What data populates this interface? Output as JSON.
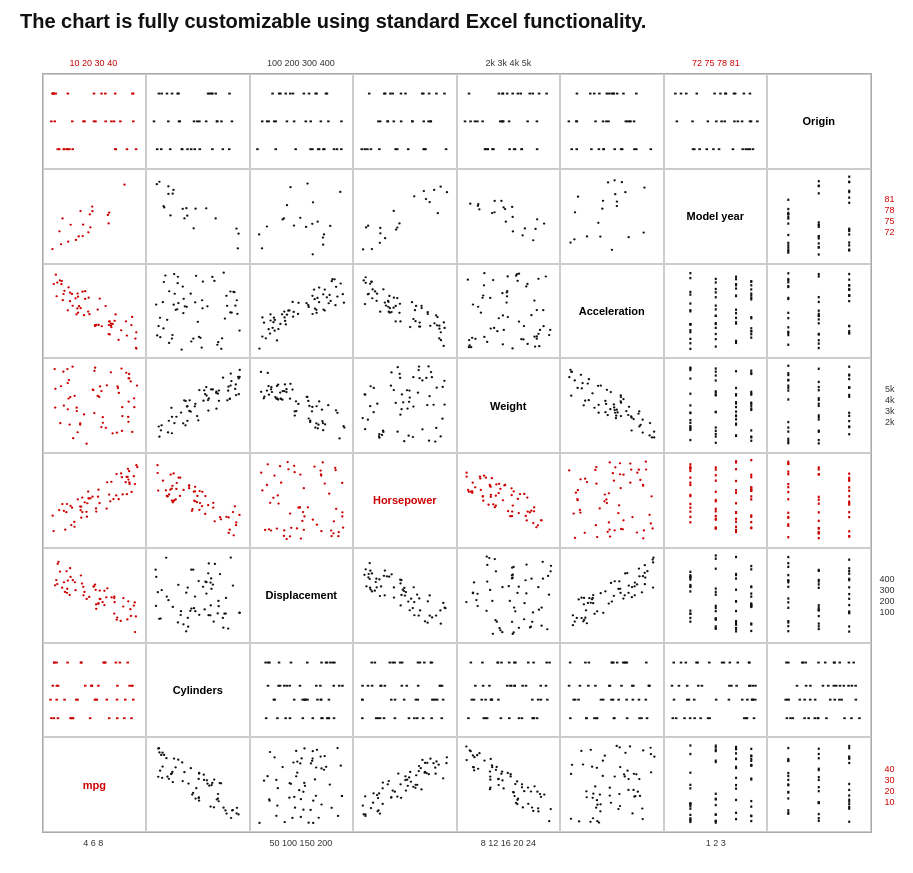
{
  "title": "The chart is fully customizable using standard Excel functionality.",
  "top_axis": {
    "col1": "10 20 30 40",
    "col2": "",
    "col3": "100 200 300 400",
    "col4": "",
    "col5": "2k 3k 4k 5k",
    "col6": "",
    "col7": "72 75 78 81",
    "col8": ""
  },
  "bottom_axis": {
    "col1": "4  6  8",
    "col2": "",
    "col3": "50 100 150 200",
    "col4": "",
    "col5": "8 12 16 20 24",
    "col6": "",
    "col7": "1  2  3",
    "col8": ""
  },
  "right_axis": {
    "row1": "",
    "row2": "81 78 75 72",
    "row3": "",
    "row4": "5k 4k 3k 2k",
    "row5": "",
    "row6": "400 300 200 100",
    "row7": "",
    "row8": "40 30 20 10"
  },
  "cell_labels": {
    "origin": "Origin",
    "model_year": "Model year",
    "acceleration": "Acceleration",
    "weight": "Weight",
    "horsepower": "Horsepower",
    "displacement": "Displacement",
    "cylinders": "Cylinders",
    "mpg": "mpg"
  },
  "colors": {
    "accent_red": "#cc0000",
    "dot_black": "#111111",
    "grid_line": "#cccccc"
  }
}
